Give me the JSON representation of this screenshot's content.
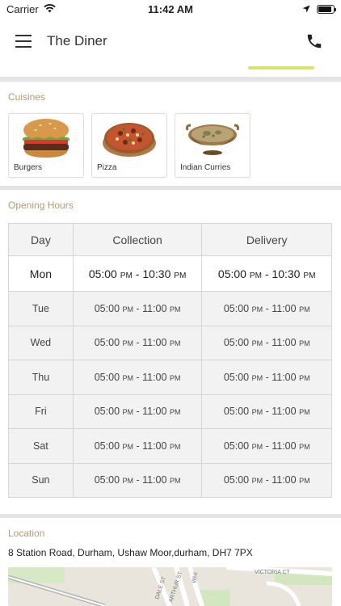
{
  "status_bar": {
    "carrier": "Carrier",
    "time": "11:42 AM",
    "battery_level": 0.9
  },
  "header": {
    "title": "The Diner",
    "menu_icon": "hamburger-menu-icon",
    "call_icon": "phone-icon"
  },
  "accent_colors": {
    "section_title": "#b39b73",
    "tab_indicator": "#d7e36a"
  },
  "cuisines": {
    "title": "Cuisines",
    "items": [
      {
        "label": "Burgers",
        "icon": "burger-image"
      },
      {
        "label": "Pizza",
        "icon": "pizza-image"
      },
      {
        "label": "Indian Curries",
        "icon": "curry-image"
      }
    ]
  },
  "opening_hours": {
    "title": "Opening Hours",
    "headers": [
      "Day",
      "Collection",
      "Delivery"
    ],
    "rows": [
      {
        "day": "Mon",
        "collection": {
          "from": "05:00",
          "from_ampm": "PM",
          "to": "10:30",
          "to_ampm": "PM"
        },
        "delivery": {
          "from": "05:00",
          "from_ampm": "PM",
          "to": "10:30",
          "to_ampm": "PM"
        }
      },
      {
        "day": "Tue",
        "collection": {
          "from": "05:00",
          "from_ampm": "PM",
          "to": "11:00",
          "to_ampm": "PM"
        },
        "delivery": {
          "from": "05:00",
          "from_ampm": "PM",
          "to": "11:00",
          "to_ampm": "PM"
        }
      },
      {
        "day": "Wed",
        "collection": {
          "from": "05:00",
          "from_ampm": "PM",
          "to": "11:00",
          "to_ampm": "PM"
        },
        "delivery": {
          "from": "05:00",
          "from_ampm": "PM",
          "to": "11:00",
          "to_ampm": "PM"
        }
      },
      {
        "day": "Thu",
        "collection": {
          "from": "05:00",
          "from_ampm": "PM",
          "to": "11:00",
          "to_ampm": "PM"
        },
        "delivery": {
          "from": "05:00",
          "from_ampm": "PM",
          "to": "11:00",
          "to_ampm": "PM"
        }
      },
      {
        "day": "Fri",
        "collection": {
          "from": "05:00",
          "from_ampm": "PM",
          "to": "11:00",
          "to_ampm": "PM"
        },
        "delivery": {
          "from": "05:00",
          "from_ampm": "PM",
          "to": "11:00",
          "to_ampm": "PM"
        }
      },
      {
        "day": "Sat",
        "collection": {
          "from": "05:00",
          "from_ampm": "PM",
          "to": "11:00",
          "to_ampm": "PM"
        },
        "delivery": {
          "from": "05:00",
          "from_ampm": "PM",
          "to": "11:00",
          "to_ampm": "PM"
        }
      },
      {
        "day": "Sun",
        "collection": {
          "from": "05:00",
          "from_ampm": "PM",
          "to": "11:00",
          "to_ampm": "PM"
        },
        "delivery": {
          "from": "05:00",
          "from_ampm": "PM",
          "to": "11:00",
          "to_ampm": "PM"
        }
      }
    ]
  },
  "location": {
    "title": "Location",
    "address": "8 Station Road, Durham, Ushaw Moor,durham, DH7 7PX",
    "map_labels": [
      "DALE ST",
      "ARTHUR ST",
      "WHI",
      "VICTORIA CT"
    ]
  }
}
